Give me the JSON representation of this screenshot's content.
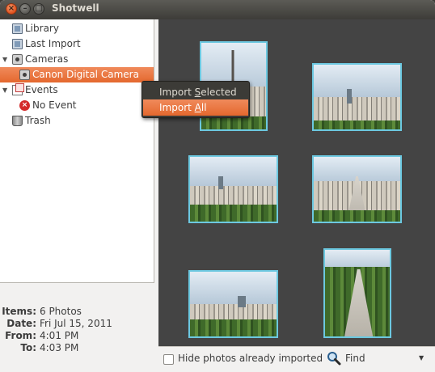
{
  "window": {
    "title": "Shotwell",
    "close_glyph": "×",
    "minimize_glyph": "–",
    "maximize_glyph": "□"
  },
  "sidebar": {
    "items": [
      {
        "label": "Library",
        "icon": "library-icon",
        "indent": 0
      },
      {
        "label": "Last Import",
        "icon": "last-import-icon",
        "indent": 0
      },
      {
        "label": "Cameras",
        "icon": "camera-icon",
        "indent": 0,
        "expanded": true
      },
      {
        "label": "Canon Digital Camera",
        "icon": "camera-icon",
        "indent": 1,
        "selected": true
      },
      {
        "label": "Events",
        "icon": "events-icon",
        "indent": 0,
        "expanded": true
      },
      {
        "label": "No Event",
        "icon": "no-event-icon",
        "indent": 1
      },
      {
        "label": "Trash",
        "icon": "trash-icon",
        "indent": 0
      }
    ]
  },
  "info": {
    "items_key": "Items:",
    "items_value": "6 Photos",
    "date_key": "Date:",
    "date_value": "Fri Jul 15, 2011",
    "from_key": "From:",
    "from_value": "4:01 PM",
    "to_key": "To:",
    "to_value": "4:03 PM"
  },
  "context_menu": {
    "import_selected_prefix": "Import ",
    "import_selected_mnemonic": "S",
    "import_selected_suffix": "elected",
    "import_all_prefix": "Import ",
    "import_all_mnemonic": "A",
    "import_all_suffix": "ll"
  },
  "toolbar": {
    "hide_imported_label": "Hide photos already imported",
    "hide_imported_checked": false,
    "find_label": "Find"
  },
  "colors": {
    "accent": "#e4682e",
    "thumb_border": "#6cc8e0",
    "photo_bg": "#444444"
  }
}
